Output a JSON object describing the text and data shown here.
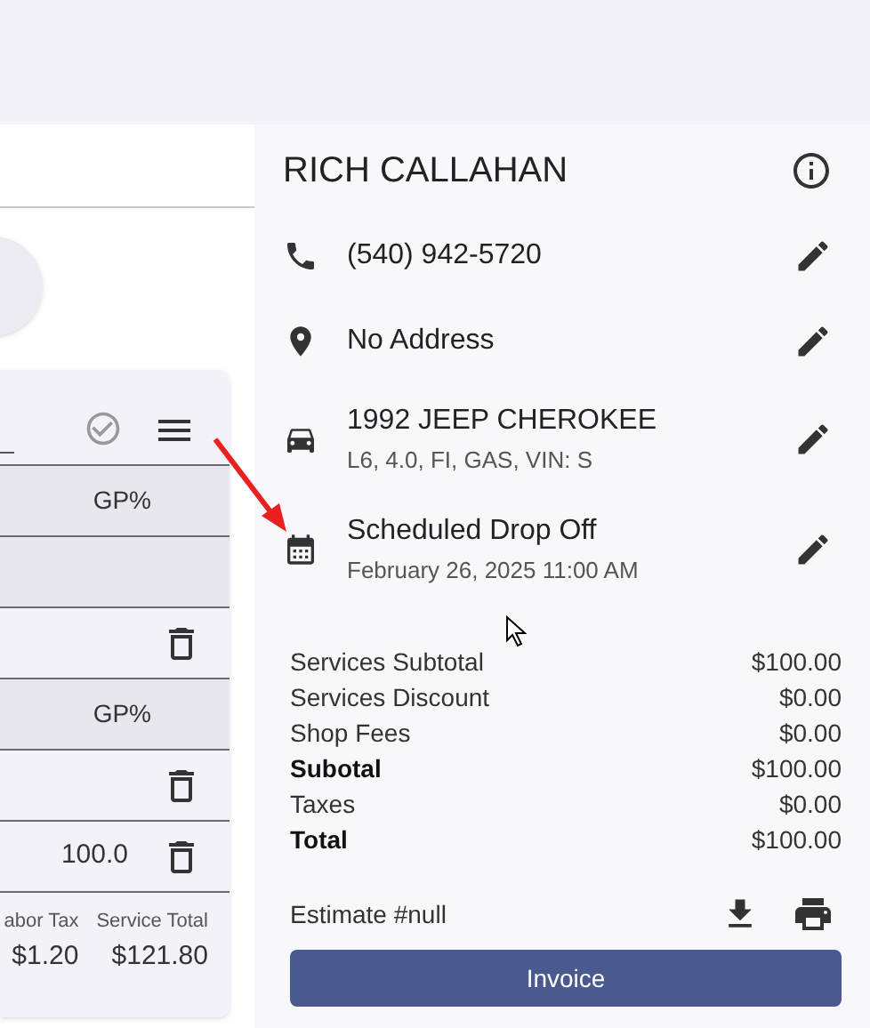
{
  "service_card": {
    "rows": [
      {
        "kind": "header",
        "text": "GP%"
      },
      {
        "kind": "blank"
      },
      {
        "kind": "item"
      },
      {
        "kind": "header",
        "text": "GP%"
      },
      {
        "kind": "item"
      },
      {
        "kind": "item",
        "text": "100.0"
      }
    ],
    "footer": [
      {
        "label": "abor Tax",
        "value": "$1.20"
      },
      {
        "label": "Service Total",
        "value": "$121.80"
      }
    ]
  },
  "customer": {
    "name": "RICH CALLAHAN"
  },
  "details": [
    {
      "kind": "phone",
      "title": "(540) 942-5720"
    },
    {
      "kind": "location",
      "title": "No Address"
    },
    {
      "kind": "vehicle",
      "title": "1992 JEEP CHEROKEE",
      "subtitle": "L6, 4.0, FI, GAS, VIN: S"
    },
    {
      "kind": "calendar",
      "title": "Scheduled Drop Off",
      "subtitle": "February 26, 2025 11:00 AM"
    }
  ],
  "totals": [
    {
      "label": "Services Subtotal",
      "value": "$100.00",
      "bold": false
    },
    {
      "label": "Services Discount",
      "value": "$0.00",
      "bold": false
    },
    {
      "label": "Shop Fees",
      "value": "$0.00",
      "bold": false
    },
    {
      "label": "Subotal",
      "value": "$100.00",
      "bold": true
    },
    {
      "label": "Taxes",
      "value": "$0.00",
      "bold": false
    },
    {
      "label": "Total",
      "value": "$100.00",
      "bold": true
    }
  ],
  "estimate": {
    "label": "Estimate #null"
  },
  "invoice_button": {
    "label": "Invoice"
  }
}
